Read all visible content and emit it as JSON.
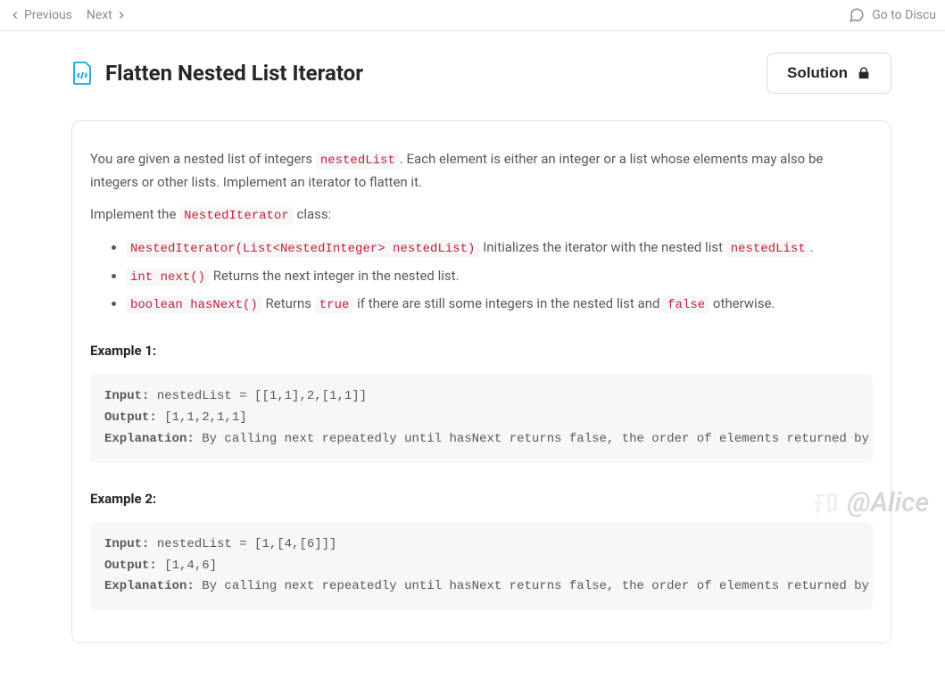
{
  "nav": {
    "prev": "Previous",
    "next": "Next",
    "discuss": "Go to Discu"
  },
  "header": {
    "title": "Flatten Nested List Iterator",
    "solution_btn": "Solution"
  },
  "body": {
    "p1_a": "You are given a nested list of integers ",
    "p1_code": "nestedList",
    "p1_b": ". Each element is either an integer or a list whose elements may also be integers or other lists. Implement an iterator to flatten it.",
    "p2_a": "Implement the ",
    "p2_code": "NestedIterator",
    "p2_b": " class:",
    "li1_code": "NestedIterator(List<NestedInteger> nestedList)",
    "li1_a": " Initializes the iterator with the nested list ",
    "li1_code2": "nestedList",
    "li1_b": ".",
    "li2_code": "int next()",
    "li2_a": " Returns the next integer in the nested list.",
    "li3_code": "boolean hasNext()",
    "li3_a": " Returns ",
    "li3_code2": "true",
    "li3_b": " if there are still some integers in the nested list and ",
    "li3_code3": "false",
    "li3_c": " otherwise."
  },
  "ex1": {
    "label": "Example 1:",
    "input_k": "Input:",
    "input_v": " nestedList = [[1,1],2,[1,1]]",
    "output_k": "Output:",
    "output_v": " [1,1,2,1,1]",
    "expl_k": "Explanation:",
    "expl_v": " By calling next repeatedly until hasNext returns false, the order of elements returned by"
  },
  "ex2": {
    "label": "Example 2:",
    "input_k": "Input:",
    "input_v": " nestedList = [1,[4,[6]]]",
    "output_k": "Output:",
    "output_v": " [1,4,6]",
    "expl_k": "Explanation:",
    "expl_v": " By calling next repeatedly until hasNext returns false, the order of elements returned by"
  },
  "watermark": "@Alice"
}
